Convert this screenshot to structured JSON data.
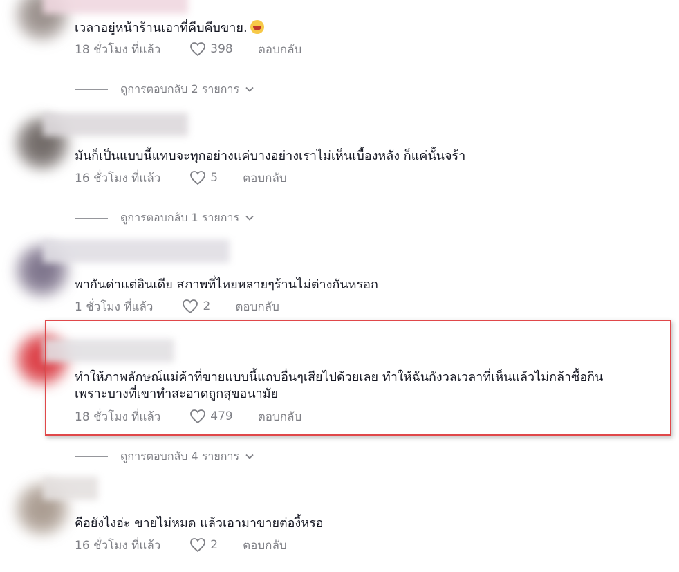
{
  "comments": [
    {
      "text": "เวลาอยู่หน้าร้านเอาที่คีบคีบขาย.",
      "emoji": "grinning-sweat-emoji",
      "time": "18 ชั่วโมง ที่แล้ว",
      "likes": "398",
      "reply_label": "ตอบกลับ",
      "view_replies": "ดูการตอบกลับ 2 รายการ"
    },
    {
      "text": "มันก็เป็นแบบนี้แทบจะทุกอย่างแค่บางอย่างเราไม่เห็นเบื้องหลัง ก็แค่นั้นจร้า",
      "time": "16 ชั่วโมง ที่แล้ว",
      "likes": "5",
      "reply_label": "ตอบกลับ",
      "view_replies": "ดูการตอบกลับ 1 รายการ"
    },
    {
      "text": "พากันด่าแต่อินเดีย สภาพที่ไหยหลายๆร้านไม่ต่างกันหรอก",
      "time": "1 ชั่วโมง ที่แล้ว",
      "likes": "2",
      "reply_label": "ตอบกลับ"
    },
    {
      "text_line1": "ทำให้ภาพลักษณ์แม่ค้าที่ขายแบบนี้แถบอื่นๆเสียไปด้วยเลย ทำให้ฉันกังวลเวลาที่เห็นแล้วไม่กล้าซื้อกิน",
      "text_line2": "เพราะบางที่เขาทำสะอาดถูกสุขอนามัย",
      "time": "18 ชั่วโมง ที่แล้ว",
      "likes": "479",
      "reply_label": "ตอบกลับ",
      "view_replies": "ดูการตอบกลับ 4 รายการ"
    },
    {
      "text": "คือยังไงอ่ะ ขายไม่หมด แล้วเอามาขายต่องี้หรอ",
      "time": "16 ชั่วโมง ที่แล้ว",
      "likes": "2",
      "reply_label": "ตอบกลับ"
    }
  ],
  "colors": {
    "highlight_border": "#e0484a",
    "text": "#161823",
    "muted": "rgba(22,24,35,0.55)"
  },
  "icons": {
    "like": "heart-outline-icon",
    "expand": "chevron-down-icon"
  }
}
